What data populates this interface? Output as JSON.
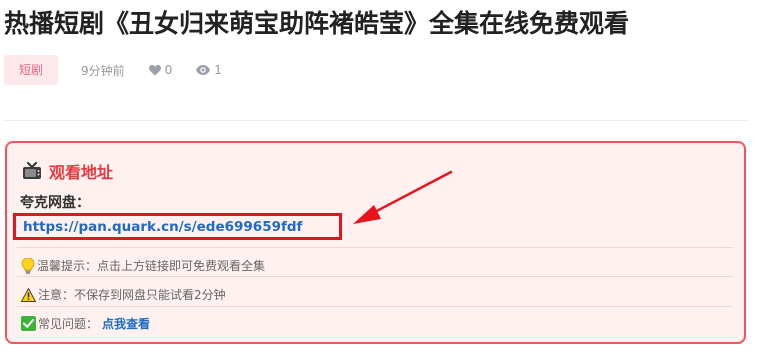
{
  "article": {
    "title": "热播短剧《丑女归来萌宝助阵褚皓莹》全集在线免费观看",
    "tag": "短剧",
    "time": "9分钟前",
    "likes": "0",
    "views": "1"
  },
  "watch_box": {
    "heading": "观看地址",
    "pan_label": "夸克网盘：",
    "link": "https://pan.quark.cn/s/ede699659fdf",
    "tip": "温馨提示：点击上方链接即可免费观看全集",
    "notice": "注意：不保存到网盘只能试看2分钟",
    "faq_label": "常见问题：",
    "faq_link": "点我查看"
  },
  "colors": {
    "tag_bg": "#fde8ec",
    "tag_text": "#e8687e",
    "box_border": "#f2545b",
    "box_bg": "#fff1f0",
    "heading": "#e8373e",
    "link": "#1e6bc6",
    "highlight": "#e8141c"
  },
  "icons": {
    "heading": "tv-icon",
    "likes": "heart-icon",
    "views": "eye-icon",
    "tip": "lightbulb-icon",
    "notice": "warning-icon",
    "faq": "check-icon"
  }
}
